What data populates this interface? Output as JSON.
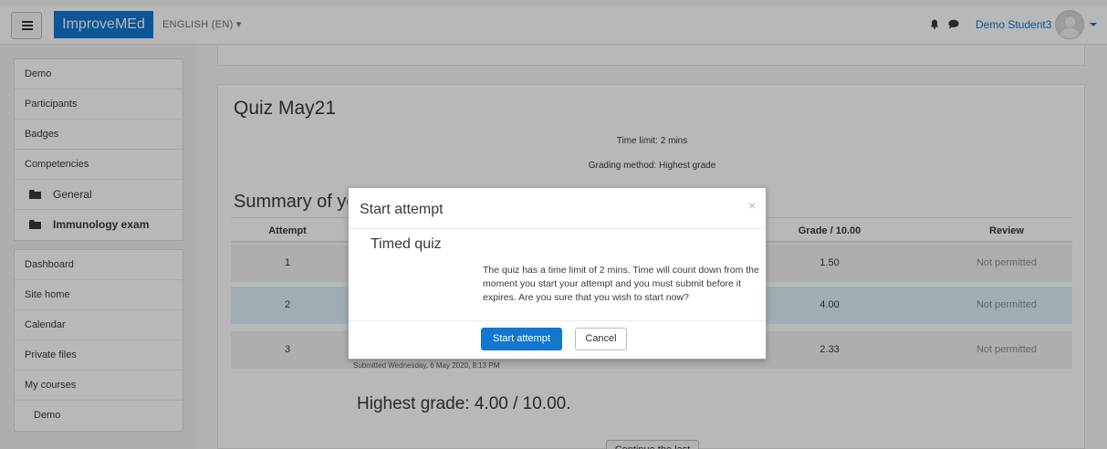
{
  "navbar": {
    "brand": "ImproveMEd",
    "language": "ENGLISH (EN) ▾",
    "user_name": "Demo Student3",
    "icons": [
      "menu-icon",
      "bell-icon",
      "chat-icon",
      "avatar",
      "caret-down-icon"
    ]
  },
  "drawer": {
    "course_nav": [
      {
        "label": "Demo"
      },
      {
        "label": "Participants"
      },
      {
        "label": "Badges"
      },
      {
        "label": "Competencies"
      },
      {
        "label": "General",
        "icon": "folder-icon"
      },
      {
        "label": "Immunology exam",
        "icon": "folder-icon",
        "active": true
      }
    ],
    "site_nav": [
      {
        "label": "Dashboard"
      },
      {
        "label": "Site home"
      },
      {
        "label": "Calendar"
      },
      {
        "label": "Private files"
      },
      {
        "label": "My courses"
      },
      {
        "label": "Demo"
      }
    ]
  },
  "quiz": {
    "title": "Quiz May21",
    "time_limit": "Time limit: 2 mins",
    "grading_method": "Grading method: Highest grade",
    "summary_title": "Summary of yo",
    "columns": {
      "attempt": "Attempt",
      "grade": "Grade / 10.00",
      "review": "Review"
    },
    "attempts": [
      {
        "attempt": "1",
        "grade": "1.50",
        "review": "Not permitted"
      },
      {
        "attempt": "2",
        "grade": "4.00",
        "review": "Not permitted"
      },
      {
        "attempt": "3",
        "grade": "2.33",
        "review": "Not permitted"
      }
    ],
    "submitted_note": "Submitted Wednesday, 6 May 2020, 8:13 PM",
    "highest_grade": "Highest grade: 4.00 / 10.00.",
    "continue_label": "Continue the last"
  },
  "modal": {
    "title": "Start attempt",
    "close": "×",
    "heading": "Timed quiz",
    "body": "The quiz has a time limit of 2 mins. Time will count down from the moment you start your attempt and you must submit before it expires. Are you sure that you wish to start now?",
    "start_label": "Start attempt",
    "cancel_label": "Cancel"
  },
  "colors": {
    "brand": "#1177d1",
    "selected_row": "#def2f8",
    "backdrop": "rgba(0,0,0,0.28)"
  }
}
